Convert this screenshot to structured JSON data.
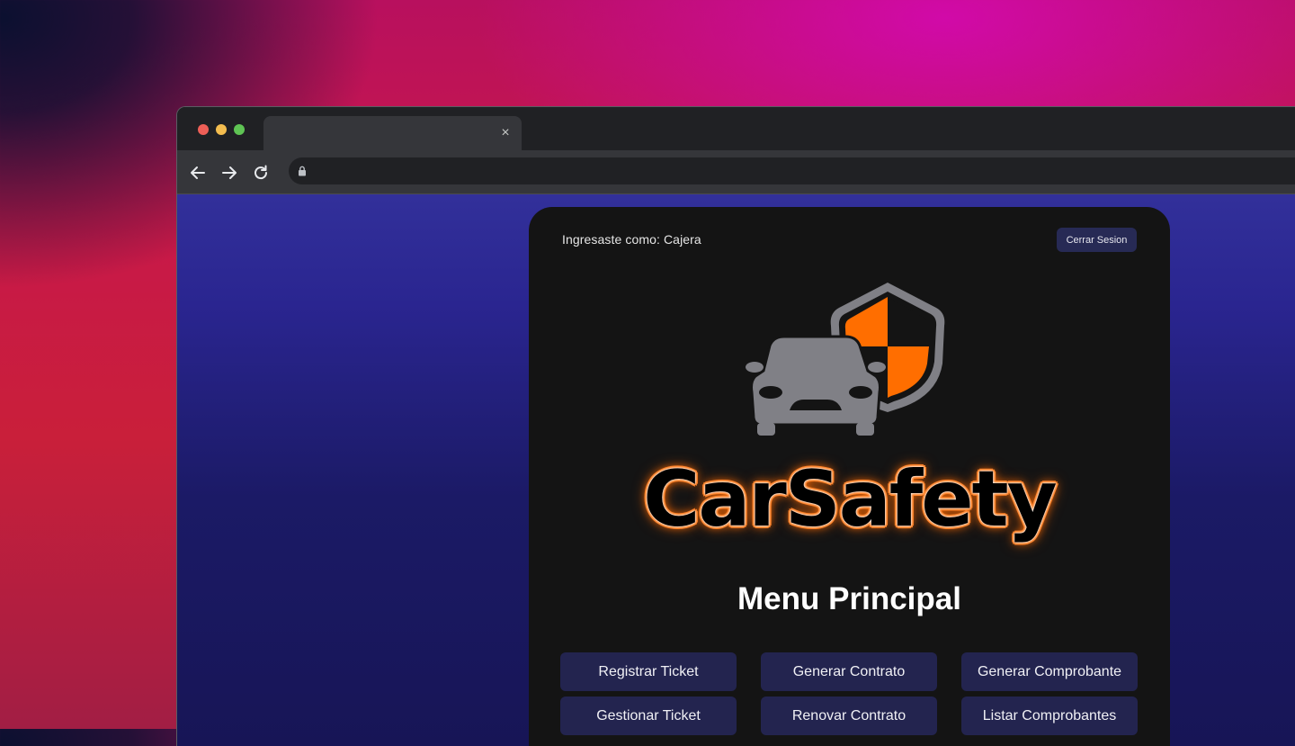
{
  "browser": {
    "tab_close": "×"
  },
  "header": {
    "user_label": "Ingresaste como: Cajera",
    "logout_label": "Cerrar Sesion"
  },
  "brand": {
    "name": "CarSafety",
    "logo_colors": {
      "car": "#808086",
      "shield": "#808086",
      "shield_accent": "#ff6e00"
    }
  },
  "menu": {
    "title": "Menu Principal",
    "buttons": [
      {
        "label": "Registrar Ticket"
      },
      {
        "label": "Generar Contrato"
      },
      {
        "label": "Generar Comprobante"
      },
      {
        "label": "Gestionar Ticket"
      },
      {
        "label": "Renovar Contrato"
      },
      {
        "label": "Listar Comprobantes"
      }
    ]
  },
  "colors": {
    "card_bg": "#141414",
    "button_bg": "#23244f",
    "page_bg": "#2a2590"
  }
}
